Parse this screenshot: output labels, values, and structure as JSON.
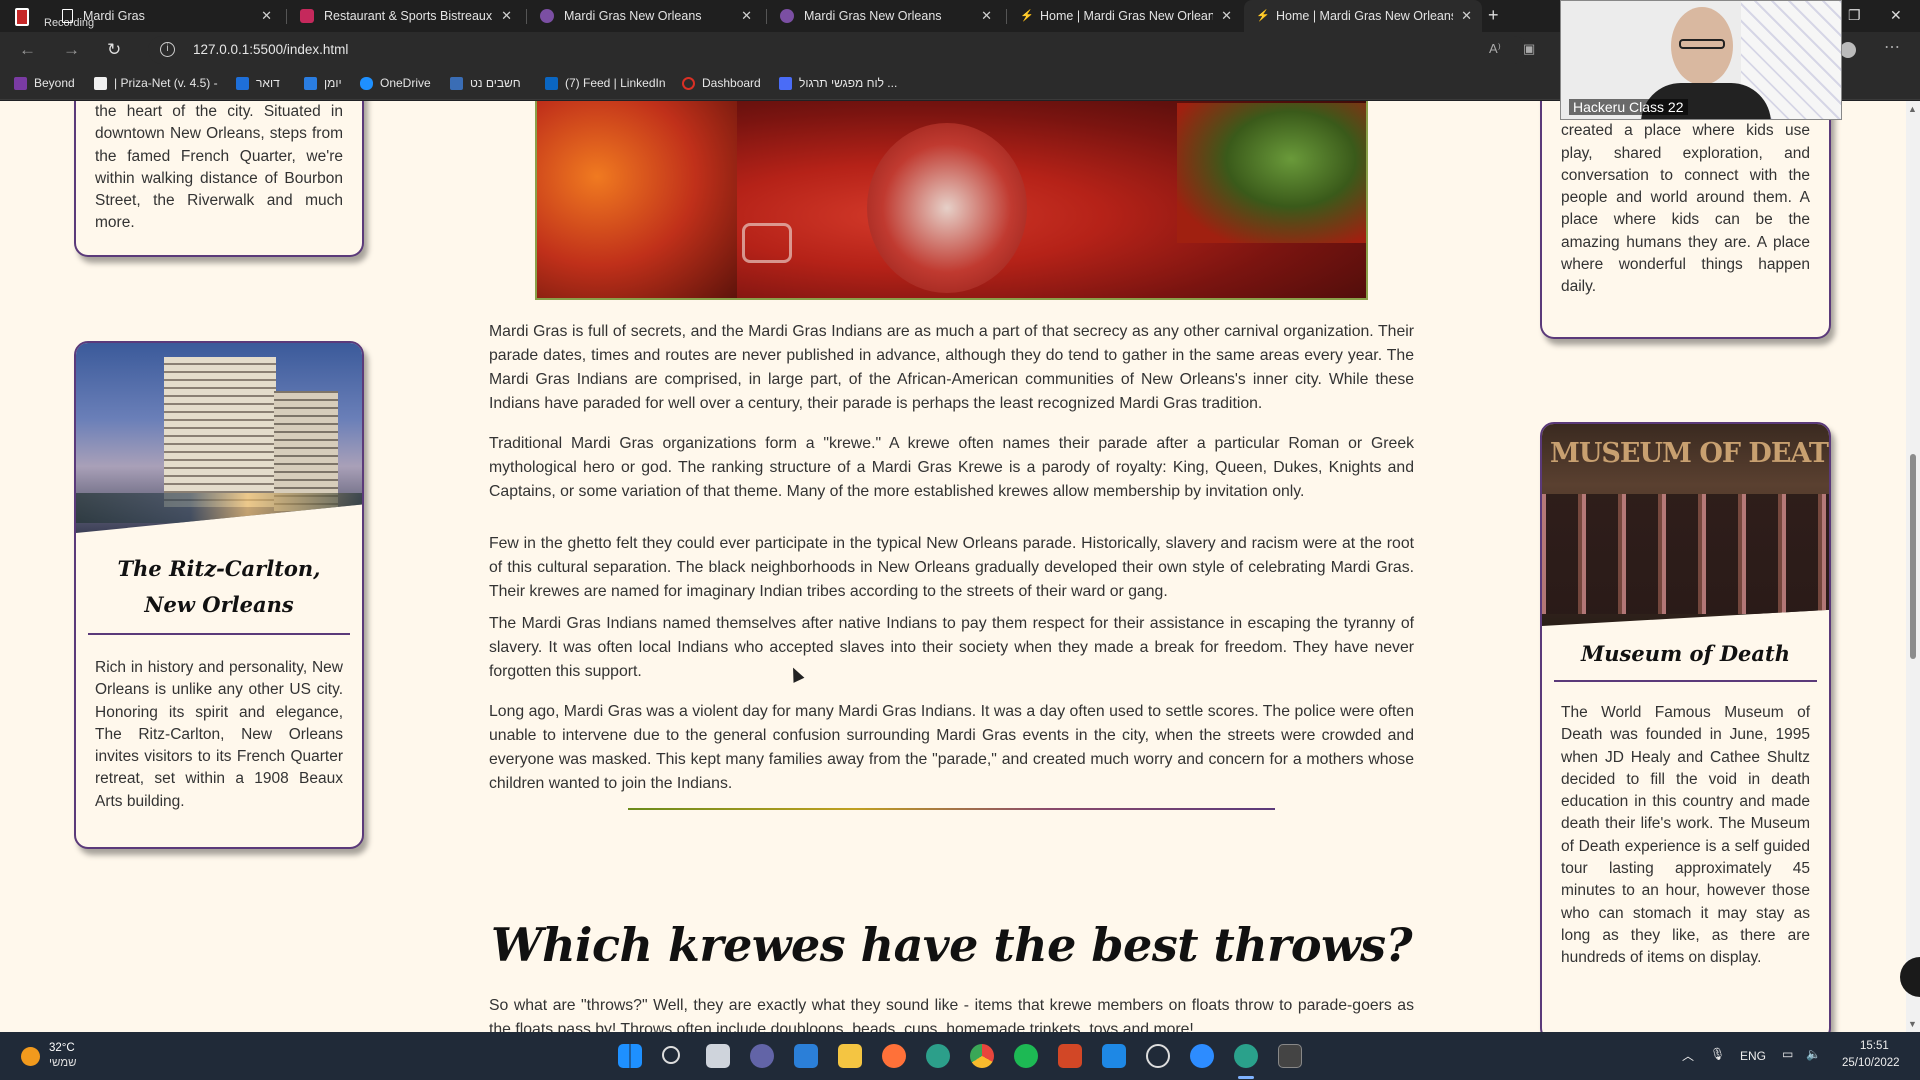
{
  "browser": {
    "recording_label": "Recording",
    "tabs": [
      {
        "title": "Mardi Gras",
        "favicon_color": "#ffffff"
      },
      {
        "title": "Restaurant & Sports Bistreaux | V",
        "favicon_color": "#c5295c"
      },
      {
        "title": "Mardi Gras New Orleans",
        "favicon_color": "#7b4fa3"
      },
      {
        "title": "Mardi Gras New Orleans",
        "favicon_color": "#7b4fa3"
      },
      {
        "title": "Home | Mardi Gras New Orleans",
        "favicon_color": "#e0b400"
      },
      {
        "title": "Home | Mardi Gras New Orleans",
        "favicon_color": "#e0b400"
      }
    ],
    "tab_close": "✕",
    "new_tab": "+",
    "url": "127.0.0.1:5500/index.html",
    "bookmarks": [
      {
        "label": "Beyond",
        "color": "#7a3ba3"
      },
      {
        "label": "| Priza-Net (v. 4.5) -",
        "color": "#f0f0f0"
      },
      {
        "label": "דואר",
        "color": "#1e6fd9"
      },
      {
        "label": "יומן",
        "color": "#2a7de1"
      },
      {
        "label": "OneDrive",
        "color": "#1e90ff"
      },
      {
        "label": "חשבים נט",
        "color": "#3a6db5"
      },
      {
        "label": "(7) Feed | LinkedIn",
        "color": "#0a66c2"
      },
      {
        "label": "Dashboard",
        "color": "#d93025"
      },
      {
        "label": "לוח מפגשי תרגול ...",
        "color": "#4a6cf7"
      }
    ]
  },
  "page": {
    "left_top_card_text": "the heart of the city. Situated in downtown New Orleans, steps from the famed French Quarter, we're within walking distance of Bourbon Street, the Riverwalk and much more.",
    "ritz_card": {
      "title": "The Ritz-Carlton, New Orleans",
      "text": "Rich in history and personality, New Orleans is unlike any other US city. Honoring its spirit and elegance, The Ritz-Carlton, New Orleans invites visitors to its French Quarter retreat, set within a 1908 Beaux Arts building."
    },
    "right_top_card_text": "wonderful things happen. So we created a place where kids use play, shared exploration, and conversation to connect with the people and world around them. A place where kids can be the amazing humans they are. A place where wonderful things happen daily.",
    "museum_card": {
      "title": "Museum of Death",
      "sign": "MUSEUM OF DEATH",
      "text": "The World Famous Museum of Death was founded in June, 1995 when JD Healy and Cathee Shultz decided to fill the void in death education in this country and made death their life's work. The Museum of Death experience is a self guided tour lasting approximately 45 minutes to an hour, however those who can stomach it may stay as long as they like, as there are hundreds of items on display."
    },
    "paragraphs": [
      "Mardi Gras is full of secrets, and the Mardi Gras Indians are as much a part of that secrecy as any other carnival organization. Their parade dates, times and routes are never published in advance, although they do tend to gather in the same areas every year. The Mardi Gras Indians are comprised, in large part, of the African-American communities of New Orleans's inner city. While these Indians have paraded for well over a century, their parade is perhaps the least recognized Mardi Gras tradition.",
      "Traditional Mardi Gras organizations form a \"krewe.\" A krewe often names their parade after a particular Roman or Greek mythological hero or god. The ranking structure of a Mardi Gras Krewe is a parody of royalty: King, Queen, Dukes, Knights and Captains, or some variation of that theme. Many of the more established krewes allow membership by invitation only.",
      "Few in the ghetto felt they could ever participate in the typical New Orleans parade. Historically, slavery and racism were at the root of this cultural separation. The black neighborhoods in New Orleans gradually developed their own style of celebrating Mardi Gras. Their krewes are named for imaginary Indian tribes according to the streets of their ward or gang.",
      "The Mardi Gras Indians named themselves after native Indians to pay them respect for their assistance in escaping the tyranny of slavery. It was often local Indians who accepted slaves into their society when they made a break for freedom. They have never forgotten this support.",
      "Long ago, Mardi Gras was a violent day for many Mardi Gras Indians. It was a day often used to settle scores. The police were often unable to intervene due to the general confusion surrounding Mardi Gras events in the city, when the streets were crowded and everyone was masked. This kept many families away from the \"parade,\" and created much worry and concern for a mothers whose children wanted to join the Indians."
    ],
    "section_heading": "Which krewes have the best throws?",
    "throws_paragraph": "So what are \"throws?\" Well, they are exactly what they sound like - items that krewe members on floats throw to parade-goers as the floats pass by! Throws often include doubloons, beads, cups, homemade trinkets, toys and more!"
  },
  "video_overlay": {
    "label": "Hackeru Class 22"
  },
  "taskbar": {
    "weather_temp": "32°C",
    "weather_desc": "שמשי",
    "language": "ENG",
    "time": "15:51",
    "date": "25/10/2022",
    "apps": [
      {
        "icon": "windows-start-icon",
        "color": "#1e90ff"
      },
      {
        "icon": "search-icon",
        "color": "#cccccc"
      },
      {
        "icon": "task-view-icon",
        "color": "#cccccc"
      },
      {
        "icon": "teams-chat-icon",
        "color": "#6264a7"
      },
      {
        "icon": "store-icon",
        "color": "#2b7fd8"
      },
      {
        "icon": "file-explorer-icon",
        "color": "#f4c542"
      },
      {
        "icon": "firefox-icon",
        "color": "#ff7139"
      },
      {
        "icon": "edge-icon",
        "color": "#2c9f8a"
      },
      {
        "icon": "chrome-icon",
        "color": "#e8453c"
      },
      {
        "icon": "spotify-icon",
        "color": "#1db954"
      },
      {
        "icon": "powerpoint-icon",
        "color": "#d24726"
      },
      {
        "icon": "vscode-icon",
        "color": "#1e88e5"
      },
      {
        "icon": "clock-app-icon",
        "color": "#cccccc"
      },
      {
        "icon": "zoom-icon",
        "color": "#2d8cff"
      },
      {
        "icon": "edge-dev-icon",
        "color": "#2aa18b"
      },
      {
        "icon": "terminal-icon",
        "color": "#444444"
      }
    ]
  }
}
